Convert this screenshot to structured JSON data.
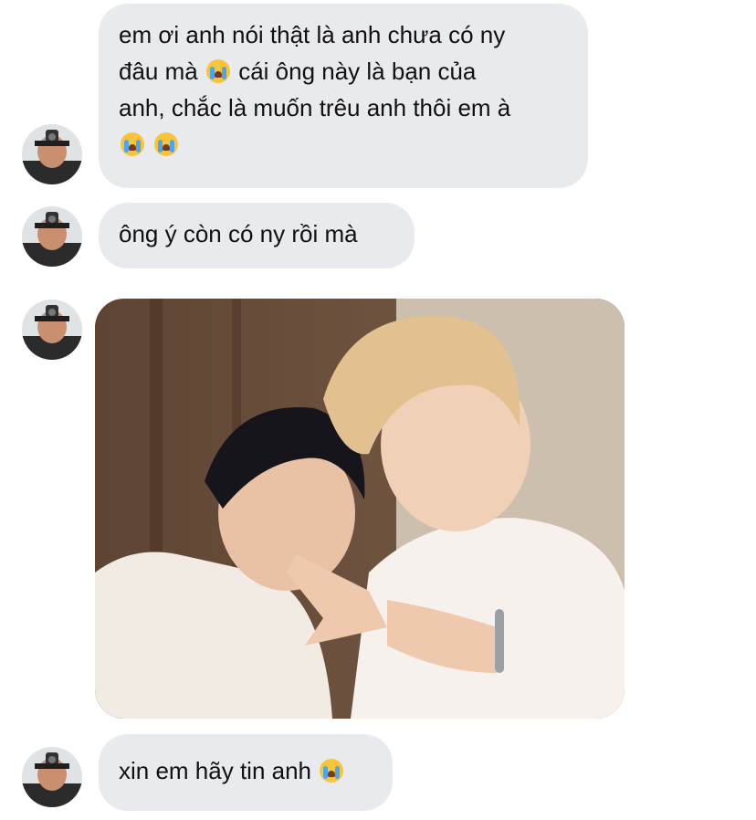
{
  "messages": [
    {
      "type": "text",
      "lines": [
        "em ơi anh nói thật là anh chưa có ny",
        "đâu mà",
        "cái ông này là bạn của",
        "anh, chắc là muốn trêu anh thôi em à"
      ]
    },
    {
      "type": "text",
      "text": "ông ý còn có ny rồi mà"
    },
    {
      "type": "photo",
      "icon": "photo-image"
    },
    {
      "type": "text",
      "text": "xin em hãy tin anh"
    }
  ],
  "emoji": "loudly-crying-face-emoji",
  "colors": {
    "bubble": "#e9eaee",
    "background": "#ffffff",
    "text": "#111111"
  }
}
